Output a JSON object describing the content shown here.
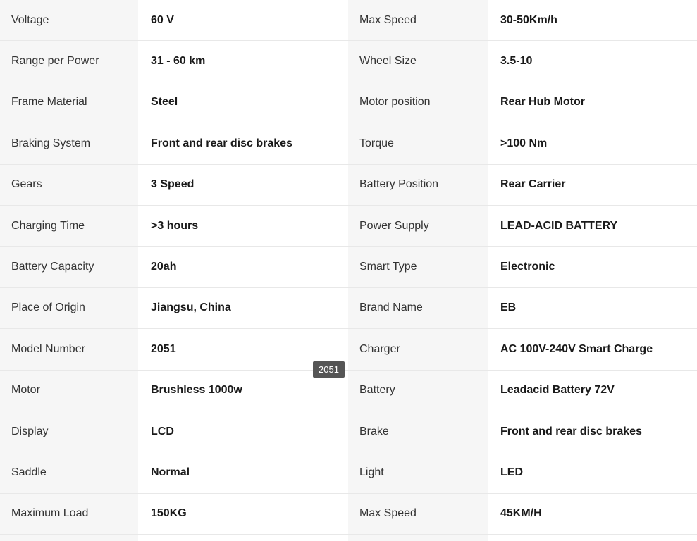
{
  "specs": [
    {
      "label_left": "Voltage",
      "value_left": "60 V",
      "label_right": "Max Speed",
      "value_right": "30-50Km/h"
    },
    {
      "label_left": "Range per Power",
      "value_left": "31 - 60 km",
      "label_right": "Wheel Size",
      "value_right": "3.5-10"
    },
    {
      "label_left": "Frame Material",
      "value_left": "Steel",
      "label_right": "Motor position",
      "value_right": "Rear Hub Motor"
    },
    {
      "label_left": "Braking System",
      "value_left": "Front and rear disc brakes",
      "label_right": "Torque",
      "value_right": ">100 Nm"
    },
    {
      "label_left": "Gears",
      "value_left": "3 Speed",
      "label_right": "Battery Position",
      "value_right": "Rear Carrier"
    },
    {
      "label_left": "Charging Time",
      "value_left": ">3 hours",
      "label_right": "Power Supply",
      "value_right": "LEAD-ACID BATTERY"
    },
    {
      "label_left": "Battery Capacity",
      "value_left": "20ah",
      "label_right": "Smart Type",
      "value_right": "Electronic"
    },
    {
      "label_left": "Place of Origin",
      "value_left": "Jiangsu, China",
      "label_right": "Brand Name",
      "value_right": "EB"
    },
    {
      "label_left": "Model Number",
      "value_left": "2051",
      "label_right": "Charger",
      "value_right": "AC 100V-240V Smart Charge"
    },
    {
      "label_left": "Motor",
      "value_left": "Brushless 1000w",
      "label_right": "Battery",
      "value_right": "Leadacid Battery 72V"
    },
    {
      "label_left": "Display",
      "value_left": "LCD",
      "label_right": "Brake",
      "value_right": "Front and rear disc brakes"
    },
    {
      "label_left": "Saddle",
      "value_left": "Normal",
      "label_right": "Light",
      "value_right": "LED"
    },
    {
      "label_left": "Maximum Load",
      "value_left": "150KG",
      "label_right": "Max Speed",
      "value_right": "45KM/H"
    }
  ],
  "tooltip": {
    "text": "2051"
  }
}
